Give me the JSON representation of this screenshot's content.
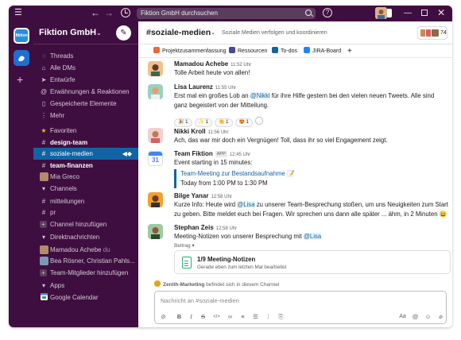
{
  "titlebar": {
    "search_text": "Fiktion GmbH durchsuchen",
    "help_label": "?"
  },
  "workspace_rail": {
    "fiktion_label": "fiktion"
  },
  "sidebar": {
    "workspace_name": "Fiktion GmbH",
    "nav": [
      {
        "label": "Threads",
        "icon": "threads-icon"
      },
      {
        "label": "Alle DMs",
        "icon": "dms-icon"
      },
      {
        "label": "Entwürfe",
        "icon": "drafts-icon"
      },
      {
        "label": "Erwähnungen & Reaktionen",
        "icon": "mentions-icon"
      },
      {
        "label": "Gespeicherte Elemente",
        "icon": "bookmark-icon"
      },
      {
        "label": "Mehr",
        "icon": "more-icon"
      }
    ],
    "favorites_label": "Favoriten",
    "favorites": [
      {
        "label": "design-team",
        "bold": true
      },
      {
        "label": "soziale-medien",
        "active": true
      },
      {
        "label": "team-finanzen",
        "bold": true
      },
      {
        "label": "Mia Greco"
      }
    ],
    "channels_label": "Channels",
    "channels": [
      "mitteilungen",
      "pr"
    ],
    "add_channel": "Channel hinzufügen",
    "dms_label": "Direktnachrichten",
    "dms": [
      {
        "label": "Mamadou Achebe",
        "suffix": "du"
      },
      {
        "label": "Bea Rösner, Christian Pahls..."
      }
    ],
    "add_members": "Team-Mitglieder hinzufügen",
    "apps_label": "Apps",
    "apps": [
      "Google Calendar"
    ]
  },
  "channel": {
    "name": "#soziale-medien",
    "topic": "Soziale Medien verfolgen und koordinieren",
    "member_count": "74",
    "bookmarks": [
      "Projektzusammenfassung",
      "Ressourcen",
      "To-dos",
      "JIRA-Board"
    ]
  },
  "messages": [
    {
      "author": "Mamadou Achebe",
      "time": "11:52 Uhr",
      "text": "Tolle Arbeit heute von allen!"
    },
    {
      "author": "Lisa Laurenz",
      "time": "11:55 Uhr",
      "text_pre": "Erst mal ein großes Lob an ",
      "mention": "@Nikki",
      "text_post": " für ihre Hilfe gestern bei den vielen neuen Tweets. Alle sind ganz begeistert von der Mitteilung.",
      "reactions": [
        {
          "emoji": "🎉",
          "count": "1"
        },
        {
          "emoji": "✨",
          "count": "1"
        },
        {
          "emoji": "👏",
          "count": "1"
        },
        {
          "emoji": "😍",
          "count": "1"
        }
      ]
    },
    {
      "author": "Nikki Kroll",
      "time": "11:56 Uhr",
      "text": "Ach, das war mir doch ein Vergnügen! Toll, dass ihr so viel Engagement zeigt."
    },
    {
      "author": "Team Fiktion",
      "app_tag": "APP",
      "time": "12:45 Uhr",
      "text": "Event starting in 15 minutes:",
      "event_title": "Team-Meeting zur Bestandsaufnahme",
      "event_time": "Today from 1:00 PM to 1:30 PM",
      "calendar_day": "31"
    },
    {
      "author": "Bilge Yanar",
      "time": "12:58 Uhr",
      "text_pre": "Kurze Info: Heute wird ",
      "mention": "@Lisa",
      "text_post": " zu unserer Team-Besprechung stoßen, um uns Neuigkeiten zum Start zu geben. Bitte meldet euch bei Fragen. Wir sprechen uns dann alle später ... ähm, in 2 Minuten 😄"
    },
    {
      "author": "Stephan Zeis",
      "time": "12:58 Uhr",
      "text_pre": "Meeting-Notizen von unserer Besprechung mit ",
      "mention": "@Lisa",
      "text_post": "",
      "contrib": "Beitrag ▾",
      "canvas_title": "1/9 Meeting-Notizen",
      "canvas_sub": "Gerade eben zum letzten Mal bearbeitet"
    }
  ],
  "external_note": {
    "name": "Zenith-Marketing",
    "text": " befindet sich in diesem Channel"
  },
  "composer": {
    "placeholder": "Nachricht an #soziale-medien"
  },
  "colors": {
    "sidebar": "#3f0e40",
    "active": "#1164a3",
    "mention": "#1264a3",
    "canvas": "#2bac76"
  }
}
